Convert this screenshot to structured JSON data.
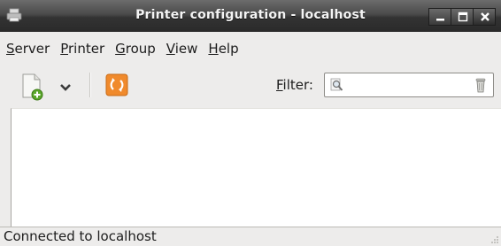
{
  "window": {
    "title": "Printer configuration - localhost"
  },
  "menubar": {
    "items": [
      {
        "mnemonic": "S",
        "rest": "erver"
      },
      {
        "mnemonic": "P",
        "rest": "rinter"
      },
      {
        "mnemonic": "G",
        "rest": "roup"
      },
      {
        "mnemonic": "V",
        "rest": "iew"
      },
      {
        "mnemonic": "H",
        "rest": "elp"
      }
    ]
  },
  "toolbar": {
    "filter_mnemonic": "F",
    "filter_rest": "ilter:",
    "filter_value": "",
    "icons": {
      "new": "new-printer-icon",
      "dropdown": "chevron-down-icon",
      "refresh": "refresh-icon",
      "search": "search-icon",
      "clear": "clear-icon"
    }
  },
  "statusbar": {
    "text": "Connected to localhost"
  },
  "colors": {
    "titlebar": "#3a3a3a",
    "window_bg": "#edeceb",
    "refresh_accent": "#f08a2c"
  }
}
